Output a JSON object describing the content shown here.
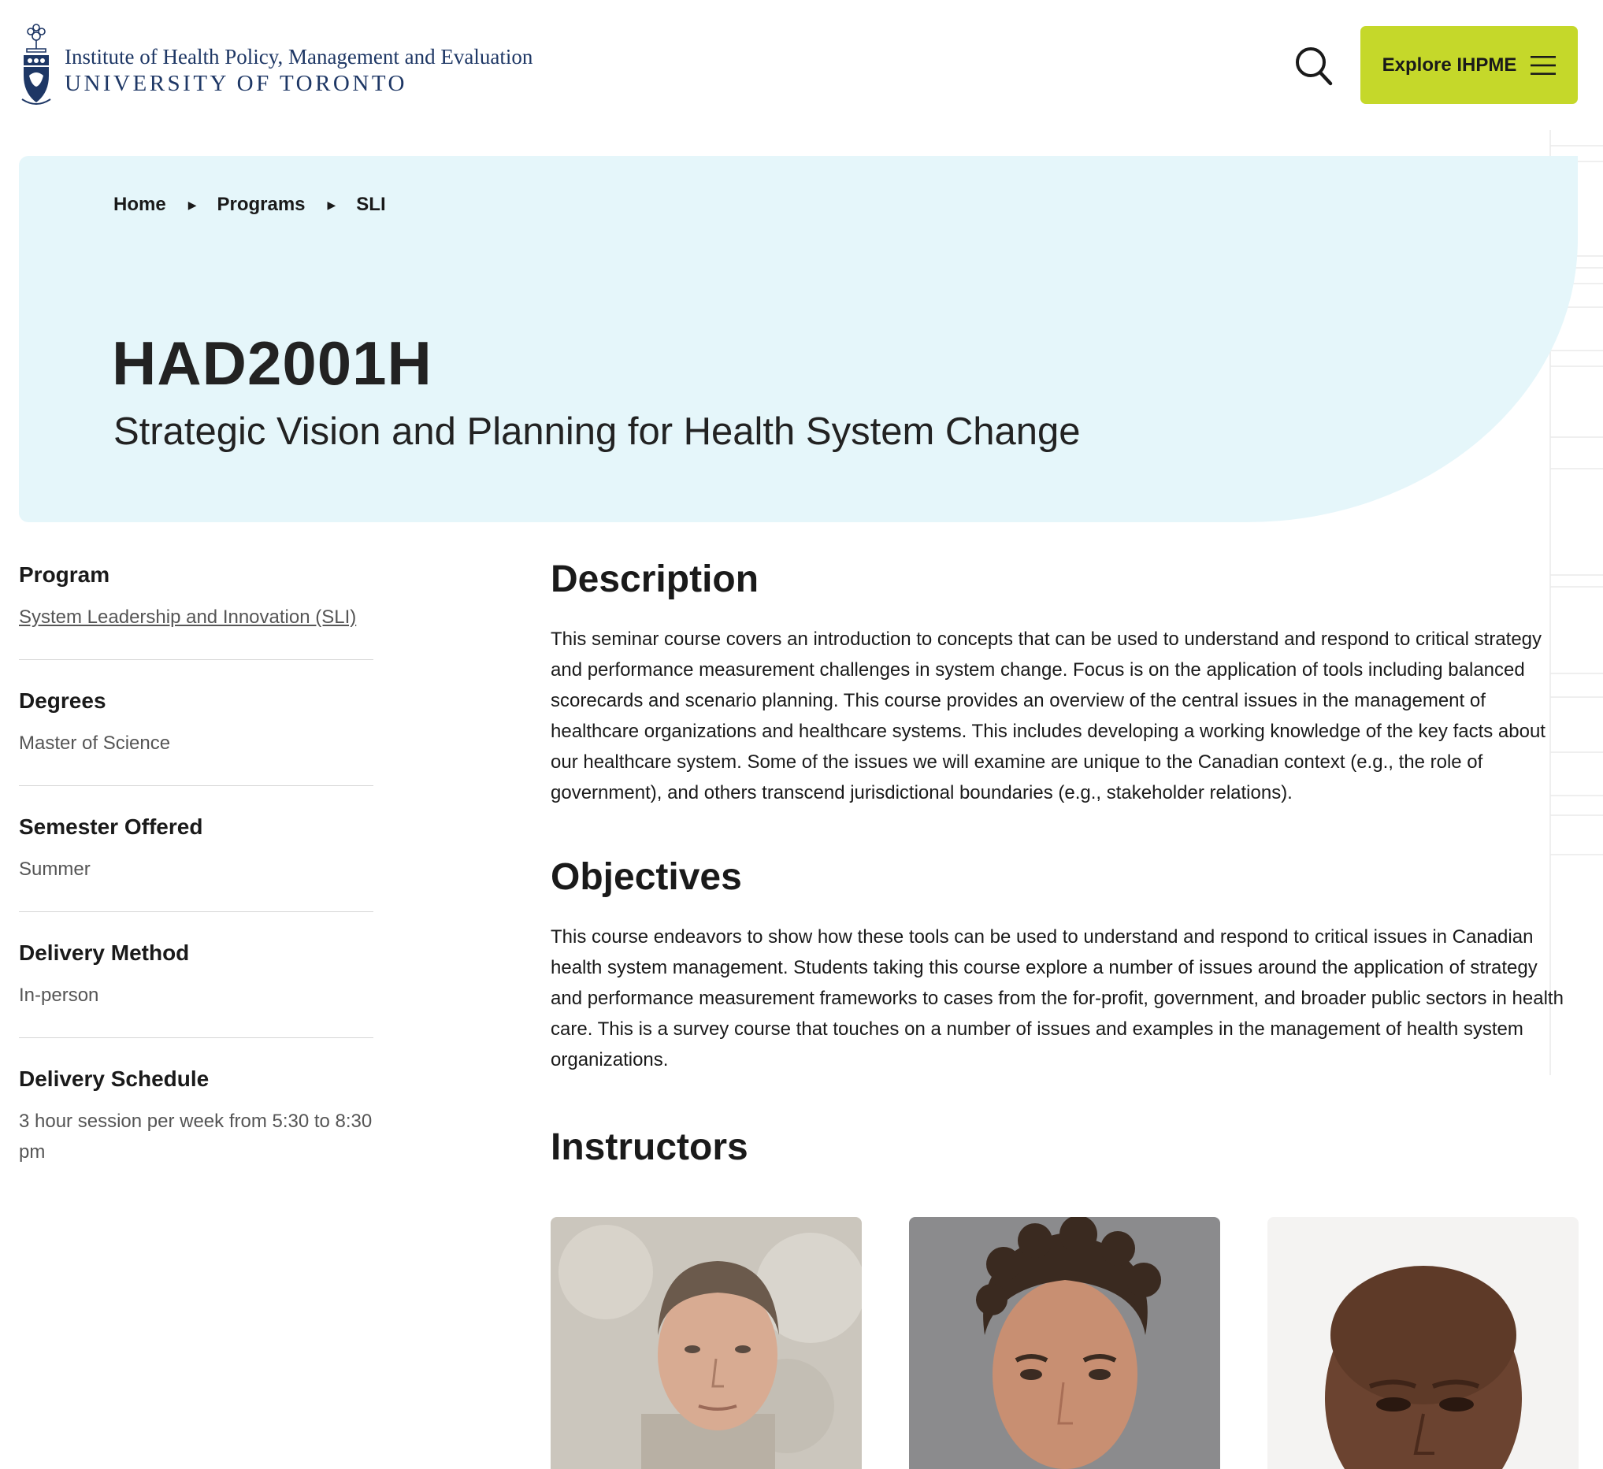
{
  "header": {
    "institute_line": "Institute of Health Policy, Management and Evaluation",
    "university_line": "UNIVERSITY OF TORONTO",
    "explore_label": "Explore IHPME",
    "accent_color": "#c5d82a",
    "brand_color": "#1e3765"
  },
  "breadcrumb": [
    {
      "label": "Home"
    },
    {
      "label": "Programs"
    },
    {
      "label": "SLI"
    }
  ],
  "hero": {
    "code": "HAD2001H",
    "title": "Strategic Vision and Planning for Health System Change",
    "background": "#e5f6fa"
  },
  "sidebar": {
    "program": {
      "label": "Program",
      "value": "System Leadership and Innovation (SLI)"
    },
    "degrees": {
      "label": "Degrees",
      "value": "Master of Science"
    },
    "semester": {
      "label": "Semester Offered",
      "value": "Summer"
    },
    "delivery_method": {
      "label": "Delivery Method",
      "value": "In-person"
    },
    "delivery_schedule": {
      "label": "Delivery Schedule",
      "value": "3 hour session per week from 5:30 to 8:30 pm"
    }
  },
  "main": {
    "description": {
      "heading": "Description",
      "text": "This seminar course covers an introduction to concepts that can be used to understand and respond to critical strategy and performance measurement challenges in system change. Focus is on the application of tools including balanced scorecards and scenario planning. This course provides an overview of the central issues in the management of healthcare organizations and healthcare systems. This includes developing a working knowledge of the key facts about our healthcare system. Some of the issues we will examine are unique to the Canadian context (e.g., the role of government), and others transcend jurisdictional boundaries (e.g., stakeholder relations)."
    },
    "objectives": {
      "heading": "Objectives",
      "text": "This course endeavors to show how these tools can be used to understand and respond to critical issues in Canadian health system management. Students taking this course explore a number of issues around the application of strategy and performance measurement frameworks to cases from the for-profit, government, and broader public sectors in health care. This is a survey course that touches on a number of issues and examples in the management of health system organizations."
    },
    "instructors": {
      "heading": "Instructors"
    }
  },
  "icons": {
    "search": "search-icon",
    "menu": "menu-icon",
    "crest": "university-crest-icon",
    "breadcrumb_separator": "caret-right-icon"
  }
}
